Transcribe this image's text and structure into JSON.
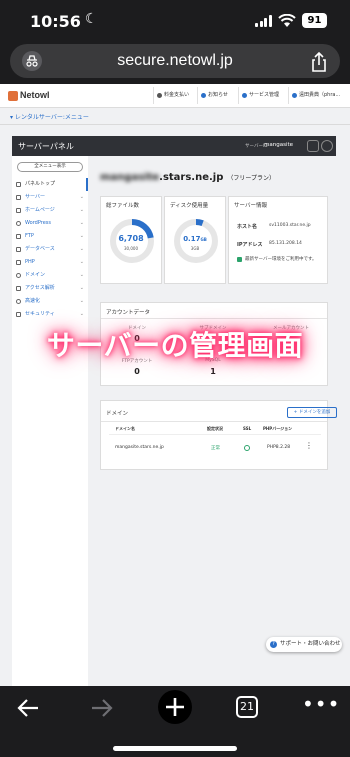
{
  "status_bar": {
    "time": "10:56",
    "battery": "91"
  },
  "browser": {
    "url": "secure.netowl.jp",
    "tab_count": "21"
  },
  "site": {
    "logo": "Netowl",
    "header_buttons": [
      "料金支払い",
      "お知らせ",
      "サービス管理",
      "遠田貴典（phra..."
    ],
    "breadcrumb": "レンタルサーバー:メニュー"
  },
  "panel": {
    "title": "サーバーパネル",
    "server_label": "サーバーID",
    "server_name": "mangasite"
  },
  "sidebar": {
    "toggle": "全メニュー表示",
    "items": [
      {
        "label": "パネルトップ",
        "active": true
      },
      {
        "label": "サーバー"
      },
      {
        "label": "ホームページ"
      },
      {
        "label": "WordPress"
      },
      {
        "label": "FTP"
      },
      {
        "label": "データベース"
      },
      {
        "label": "PHP"
      },
      {
        "label": "ドメイン"
      },
      {
        "label": "アクセス解析"
      },
      {
        "label": "高速化"
      },
      {
        "label": "セキュリティ"
      }
    ]
  },
  "main": {
    "domain_hidden": "mangasite",
    "domain_visible": ".stars.ne.jp",
    "plan": "（フリープラン）",
    "files_card": {
      "title": "総ファイル数",
      "value": "6,708",
      "max": "30,000",
      "ratio": 0.2236
    },
    "disk_card": {
      "title": "ディスク使用量",
      "value": "0.17",
      "unit": "GB",
      "max": "3GB",
      "ratio": 0.057
    },
    "server_info": {
      "title": "サーバー情報",
      "host_label": "ホスト名",
      "host": "sv11003.star.ne.jp",
      "ip_label": "IPアドレス",
      "ip": "85.131.208.14",
      "status": "最新サーバー環境をご利用中です。"
    },
    "account": {
      "title": "アカウントデータ",
      "domain_label": "ドメイン",
      "domain_count": "0",
      "subdomain_label": "サブドメイン",
      "mail_label": "メールアカウント",
      "ftp_label": "FTPアカウント",
      "ftp_count": "0",
      "db_label": "MySQL",
      "db_count": "1"
    },
    "domain_section": {
      "title": "ドメイン",
      "add_button": "+ ドメインを追加",
      "columns": [
        "ドメイン名",
        "設定状況",
        "SSL",
        "PHPバージョン"
      ],
      "rows": [
        {
          "domain": "mangasite.stars.ne.jp",
          "status": "正常",
          "php": "PHP8.2.28"
        }
      ]
    }
  },
  "overlay_caption": "サーバーの管理画面",
  "support_button": "サポート・お問い合わせ",
  "colors": {
    "accent": "#2a6fc9",
    "caption_glow": "#ff2a6a",
    "panel_bar": "#2f3136"
  }
}
